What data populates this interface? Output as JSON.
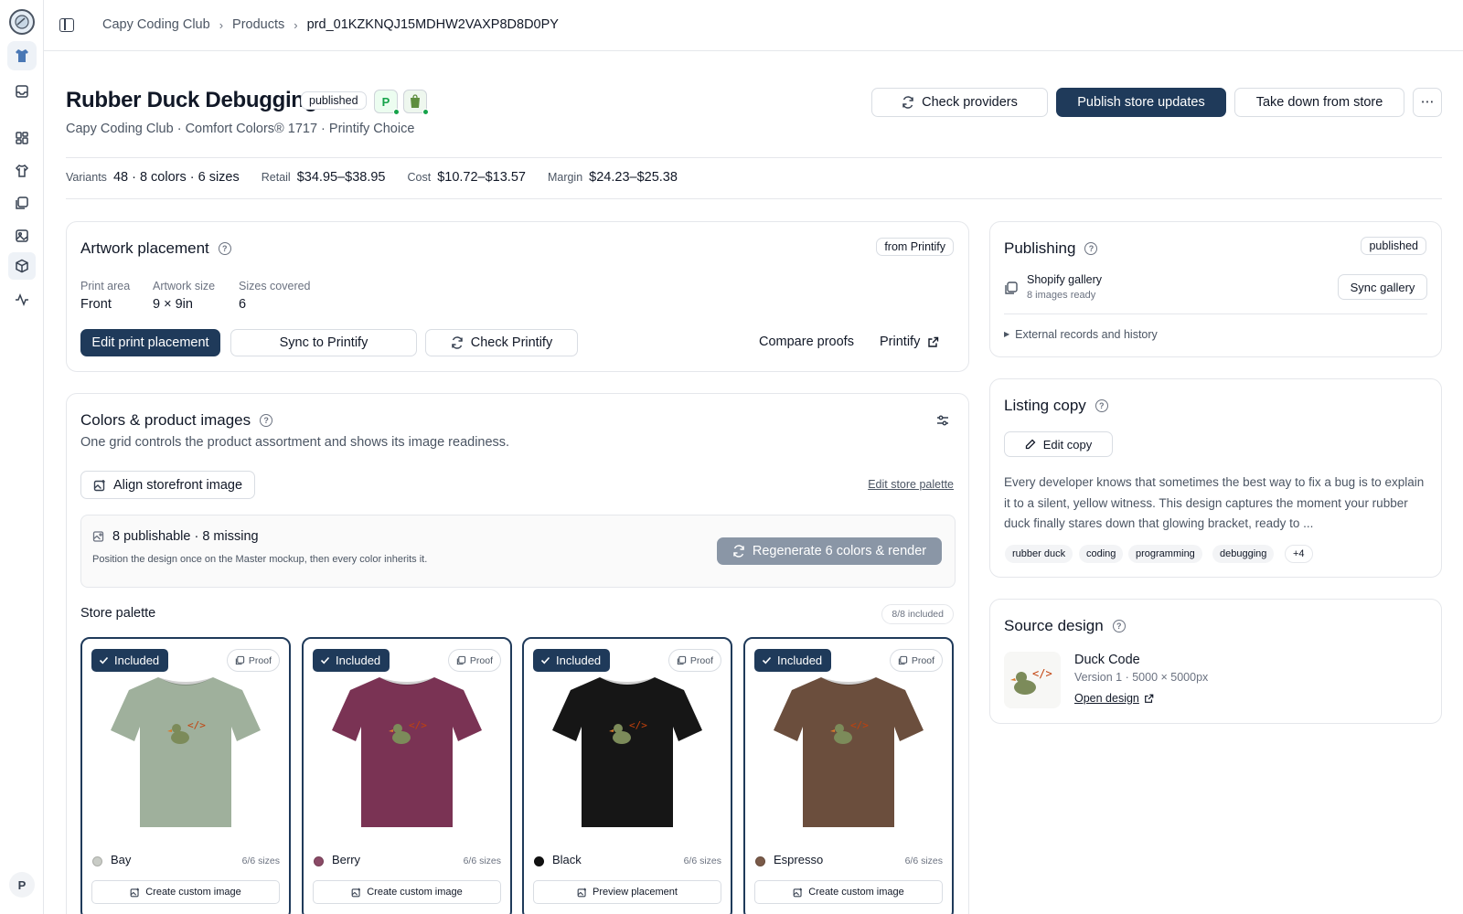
{
  "rail": {
    "user_initial": "P"
  },
  "breadcrumb": {
    "items": [
      "Capy Coding Club",
      "Products",
      "prd_01KZKNQJ15MDHW2VAXP8D8D0PY"
    ]
  },
  "product": {
    "title": "Rubber Duck Debugging",
    "status": "published",
    "subtitle": "Capy Coding Club · Comfort Colors® 1717 · Printify Choice",
    "provider_icons": [
      "printify-icon",
      "shopify-icon"
    ]
  },
  "header_actions": {
    "check_providers": "Check providers",
    "publish": "Publish store updates",
    "take_down": "Take down from store"
  },
  "stats": {
    "variants_label": "Variants",
    "variants": "48 · 8 colors · 6 sizes",
    "retail_label": "Retail",
    "retail": "$34.95–$38.95",
    "cost_label": "Cost",
    "cost": "$10.72–$13.57",
    "margin_label": "Margin",
    "margin": "$24.23–$25.38"
  },
  "artwork": {
    "title": "Artwork placement",
    "source_badge": "from Printify",
    "print_area_label": "Print area",
    "print_area": "Front",
    "artwork_size_label": "Artwork size",
    "artwork_size": "9 × 9in",
    "sizes_covered_label": "Sizes covered",
    "sizes_covered": "6",
    "edit_button": "Edit print placement",
    "sync_button": "Sync to Printify",
    "check_button": "Check Printify",
    "compare_link": "Compare proofs",
    "printify_link": "Printify"
  },
  "colors": {
    "title": "Colors & product images",
    "description": "One grid controls the product assortment and shows its image readiness.",
    "align_button": "Align storefront image",
    "edit_palette_link": "Edit store palette",
    "summary": "8 publishable · 8 missing",
    "summary_note": "Position the design once on the Master mockup, then every color inherits it.",
    "regenerate_button": "Regenerate 6 colors & render",
    "palette_title": "Store palette",
    "palette_count": "8/8 included",
    "tiles": [
      {
        "included": "Included",
        "proof": "Proof",
        "name": "Bay",
        "sizes": "6/6 sizes",
        "action": "Create custom image",
        "color": "#9fb09c",
        "swatch": "#c9ccc6"
      },
      {
        "included": "Included",
        "proof": "Proof",
        "name": "Berry",
        "sizes": "6/6 sizes",
        "action": "Create custom image",
        "color": "#7a3354",
        "swatch": "#8a4a66"
      },
      {
        "included": "Included",
        "proof": "Proof",
        "name": "Black",
        "sizes": "6/6 sizes",
        "action": "Preview placement",
        "color": "#161616",
        "swatch": "#111111"
      },
      {
        "included": "Included",
        "proof": "Proof",
        "name": "Espresso",
        "sizes": "6/6 sizes",
        "action": "Create custom image",
        "color": "#6b4e3d",
        "swatch": "#7a5a48"
      }
    ]
  },
  "publishing": {
    "title": "Publishing",
    "status": "published",
    "gallery_name": "Shopify gallery",
    "gallery_note": "8 images ready",
    "sync_button": "Sync gallery",
    "external_toggle": "External records and history"
  },
  "listing": {
    "title": "Listing copy",
    "edit_button": "Edit copy",
    "body": "Every developer knows that sometimes the best way to fix a bug is to explain it to a silent, yellow witness. This design captures the moment your rubber duck finally stares down that glowing bracket, ready to ...",
    "tags": [
      "rubber duck",
      "coding",
      "programming",
      "debugging",
      "+4"
    ]
  },
  "source_design": {
    "title": "Source design",
    "name": "Duck Code",
    "meta": "Version 1 · 5000 × 5000px",
    "open_link": "Open design"
  }
}
